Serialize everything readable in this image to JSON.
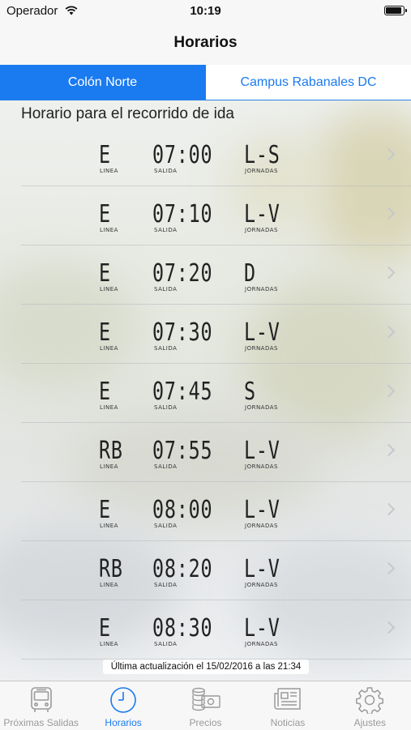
{
  "status_bar": {
    "carrier": "Operador",
    "time": "10:19",
    "battery_level": 1.0
  },
  "nav": {
    "title": "Horarios"
  },
  "segments": [
    {
      "label": "Colón Norte",
      "selected": true
    },
    {
      "label": "Campus Rabanales DC",
      "selected": false
    }
  ],
  "section_title": "Horario para el recorrido de ida",
  "captions": {
    "line": "LINEA",
    "departure": "SALIDA",
    "days": "JORNADAS"
  },
  "schedule": [
    {
      "line": "E",
      "time": "07:00",
      "days": "L-S"
    },
    {
      "line": "E",
      "time": "07:10",
      "days": "L-V"
    },
    {
      "line": "E",
      "time": "07:20",
      "days": "D"
    },
    {
      "line": "E",
      "time": "07:30",
      "days": "L-V"
    },
    {
      "line": "E",
      "time": "07:45",
      "days": "S"
    },
    {
      "line": "RB",
      "time": "07:55",
      "days": "L-V"
    },
    {
      "line": "E",
      "time": "08:00",
      "days": "L-V"
    },
    {
      "line": "RB",
      "time": "08:20",
      "days": "L-V"
    },
    {
      "line": "E",
      "time": "08:30",
      "days": "L-V"
    }
  ],
  "last_update": "Última actualización el 15/02/2016 a las 21:34",
  "tabs": [
    {
      "label": "Próximas Salidas",
      "icon": "bus-icon",
      "active": false
    },
    {
      "label": "Horarios",
      "icon": "clock-icon",
      "active": true
    },
    {
      "label": "Precios",
      "icon": "coins-icon",
      "active": false
    },
    {
      "label": "Noticias",
      "icon": "newspaper-icon",
      "active": false
    },
    {
      "label": "Ajustes",
      "icon": "gear-icon",
      "active": false
    }
  ],
  "colors": {
    "accent": "#1a7af0",
    "inactive": "#9a9a9a"
  }
}
